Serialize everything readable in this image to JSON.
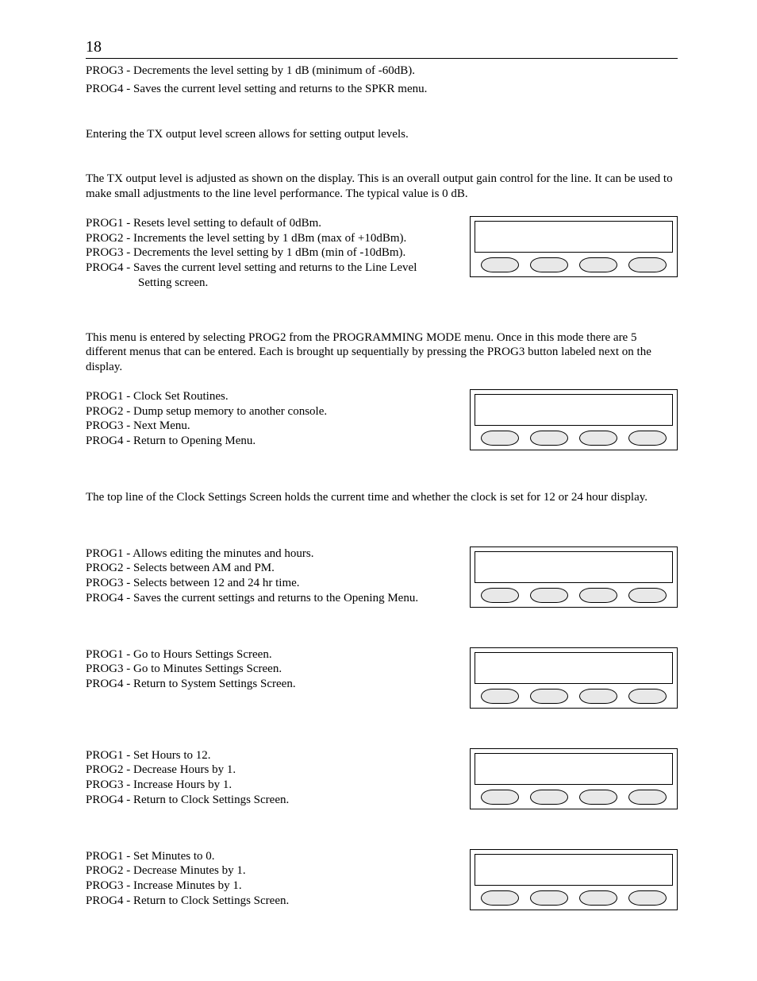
{
  "pageNumber": "18",
  "intro": {
    "line1": "PROG3 - Decrements the level setting by 1 dB (minimum of -60dB).",
    "line2": "PROG4 - Saves the current level setting and returns to the SPKR menu."
  },
  "txIntro": "Entering the TX output level screen allows for setting output levels.",
  "txDesc": "The TX output level is adjusted as shown on the display.  This is an overall output gain control for the line.  It can be used to make small adjustments to the line level performance.  The typical value is 0 dB.",
  "txProg": {
    "p1": "PROG1 - Resets level setting to default of 0dBm.",
    "p2": "PROG2 - Increments the level setting by 1 dBm (max of +10dBm).",
    "p3": "PROG3 - Decrements the level setting by 1 dBm (min of -10dBm).",
    "p4a": "PROG4 - Saves the current level setting and returns to the Line Level",
    "p4b": "Setting screen."
  },
  "sysDesc": "This menu is entered by selecting PROG2 from the PROGRAMMING MODE menu.  Once in this mode there are 5 different menus that can be entered.  Each is brought up sequentially by pressing the PROG3 button labeled next on the display.",
  "sysProg": {
    "p1": "PROG1 - Clock Set Routines.",
    "p2": "PROG2 - Dump setup memory to another console.",
    "p3": "PROG3 - Next Menu.",
    "p4": "PROG4 - Return to Opening Menu."
  },
  "clockDesc": "The top line of the Clock Settings Screen holds the current time and whether the clock is set for 12 or 24 hour display.",
  "clockProg": {
    "p1": "PROG1 - Allows editing the minutes and hours.",
    "p2": "PROG2 - Selects between AM and PM.",
    "p3": "PROG3 - Selects between 12 and 24 hr time.",
    "p4": "PROG4 - Saves the current settings and returns to the Opening Menu."
  },
  "editClockProg": {
    "p1": "PROG1 - Go to Hours Settings Screen.",
    "p3": "PROG3 - Go to Minutes Settings Screen.",
    "p4": "PROG4 - Return to System Settings Screen."
  },
  "hoursProg": {
    "p1": "PROG1 - Set Hours to 12.",
    "p2": "PROG2 - Decrease Hours by 1.",
    "p3": "PROG3 - Increase Hours by 1.",
    "p4": "PROG4 - Return to Clock Settings Screen."
  },
  "minutesProg": {
    "p1": "PROG1 - Set Minutes to 0.",
    "p2": "PROG2 - Decrease Minutes by 1.",
    "p3": "PROG3 - Increase Minutes by 1.",
    "p4": "PROG4 - Return to Clock Settings Screen."
  }
}
